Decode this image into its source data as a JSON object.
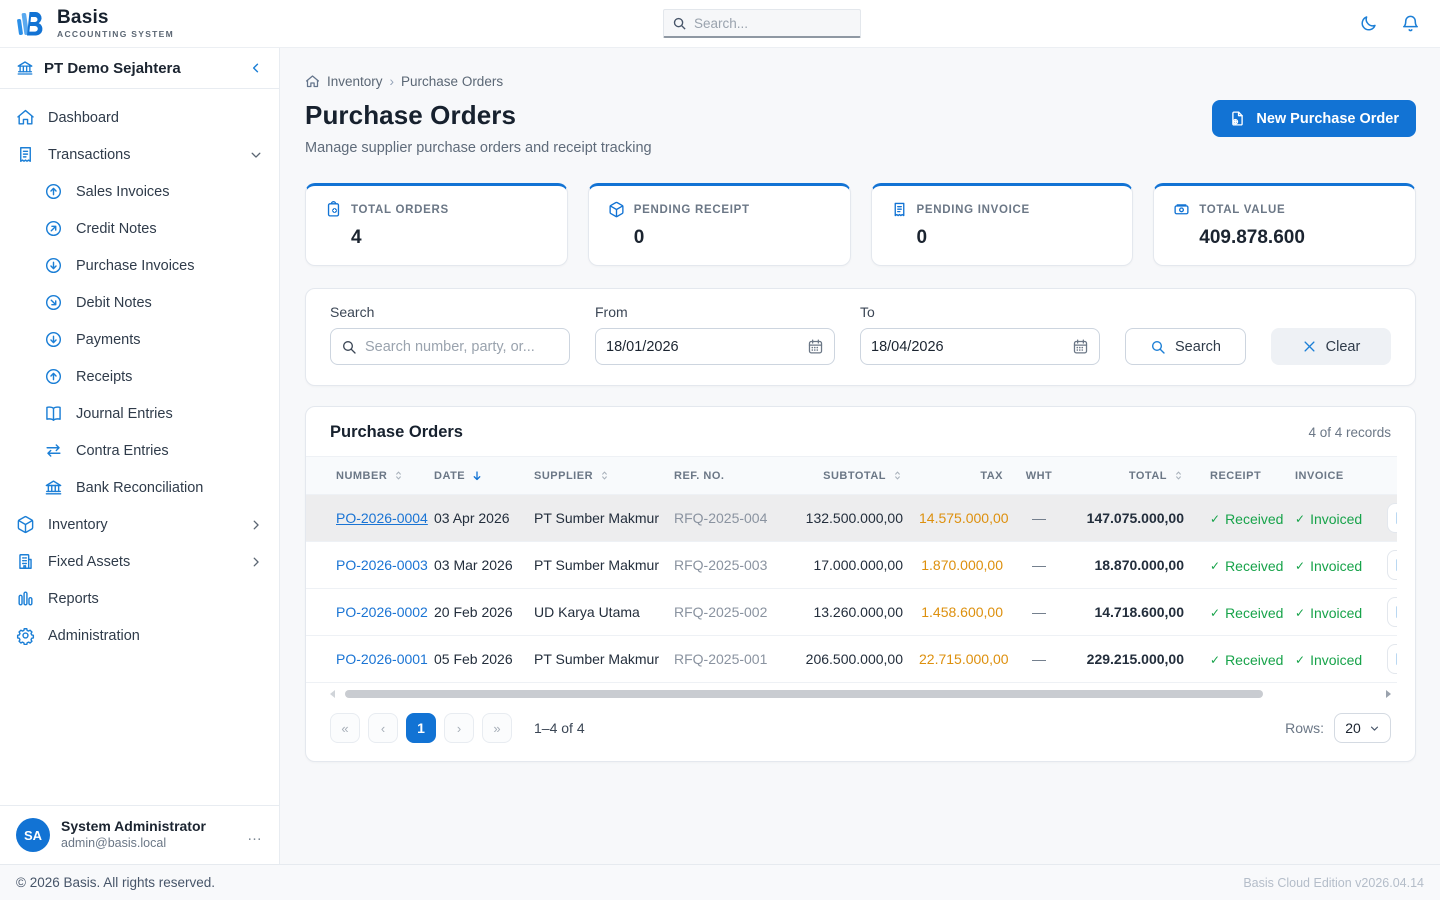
{
  "brand": {
    "name": "Basis",
    "tagline": "ACCOUNTING SYSTEM"
  },
  "topbar": {
    "search_placeholder": "Search..."
  },
  "sidebar": {
    "company": "PT Demo Sejahtera",
    "items": [
      {
        "label": "Dashboard",
        "icon": "home-icon"
      },
      {
        "label": "Transactions",
        "icon": "invoice-icon",
        "expanded": true,
        "children": [
          {
            "label": "Sales Invoices",
            "icon": "circle-arrow-up-icon"
          },
          {
            "label": "Credit Notes",
            "icon": "circle-arrow-up-right-icon"
          },
          {
            "label": "Purchase Invoices",
            "icon": "circle-arrow-down-icon"
          },
          {
            "label": "Debit Notes",
            "icon": "circle-arrow-down-right-icon"
          },
          {
            "label": "Payments",
            "icon": "circle-arrow-down-icon"
          },
          {
            "label": "Receipts",
            "icon": "circle-arrow-up-icon"
          },
          {
            "label": "Journal Entries",
            "icon": "book-open-icon"
          },
          {
            "label": "Contra Entries",
            "icon": "swap-arrows-icon"
          },
          {
            "label": "Bank Reconciliation",
            "icon": "bank-icon"
          }
        ]
      },
      {
        "label": "Inventory",
        "icon": "box-icon"
      },
      {
        "label": "Fixed Assets",
        "icon": "building-icon"
      },
      {
        "label": "Reports",
        "icon": "bar-chart-icon"
      },
      {
        "label": "Administration",
        "icon": "gear-icon"
      }
    ],
    "user": {
      "initials": "SA",
      "name": "System Administrator",
      "email": "admin@basis.local"
    }
  },
  "breadcrumb": {
    "item1": "Inventory",
    "item2": "Purchase Orders"
  },
  "page": {
    "title": "Purchase Orders",
    "subtitle": "Manage supplier purchase orders and receipt tracking",
    "new_button": "New Purchase Order"
  },
  "stats": [
    {
      "label": "TOTAL ORDERS",
      "value": "4",
      "icon": "clipboard-plus-icon"
    },
    {
      "label": "PENDING RECEIPT",
      "value": "0",
      "icon": "box-icon"
    },
    {
      "label": "PENDING INVOICE",
      "value": "0",
      "icon": "invoice-icon"
    },
    {
      "label": "TOTAL VALUE",
      "value": "409.878.600",
      "icon": "banknote-icon"
    }
  ],
  "filters": {
    "search_label": "Search",
    "search_placeholder": "Search number, party, or...",
    "from_label": "From",
    "from_value": "18/01/2026",
    "to_label": "To",
    "to_value": "18/04/2026",
    "search_button": "Search",
    "clear_button": "Clear"
  },
  "table": {
    "title": "Purchase Orders",
    "records_text": "4 of 4 records",
    "columns": {
      "number": "NUMBER",
      "date": "DATE",
      "supplier": "SUPPLIER",
      "ref": "REF. NO.",
      "subtotal": "SUBTOTAL",
      "tax": "TAX",
      "wht": "WHT",
      "total": "TOTAL",
      "receipt": "RECEIPT",
      "invoice": "INVOICE"
    },
    "rows": [
      {
        "number": "PO-2026-0004",
        "date": "03 Apr 2026",
        "supplier": "PT Sumber Makmur",
        "ref": "RFQ-2025-004",
        "subtotal": "132.500.000,00",
        "tax": "14.575.000,00",
        "wht": "—",
        "total": "147.075.000,00",
        "receipt": "Received",
        "invoice": "Invoiced"
      },
      {
        "number": "PO-2026-0003",
        "date": "03 Mar 2026",
        "supplier": "PT Sumber Makmur",
        "ref": "RFQ-2025-003",
        "subtotal": "17.000.000,00",
        "tax": "1.870.000,00",
        "wht": "—",
        "total": "18.870.000,00",
        "receipt": "Received",
        "invoice": "Invoiced"
      },
      {
        "number": "PO-2026-0002",
        "date": "20 Feb 2026",
        "supplier": "UD Karya Utama",
        "ref": "RFQ-2025-002",
        "subtotal": "13.260.000,00",
        "tax": "1.458.600,00",
        "wht": "—",
        "total": "14.718.600,00",
        "receipt": "Received",
        "invoice": "Invoiced"
      },
      {
        "number": "PO-2026-0001",
        "date": "05 Feb 2026",
        "supplier": "PT Sumber Makmur",
        "ref": "RFQ-2025-001",
        "subtotal": "206.500.000,00",
        "tax": "22.715.000,00",
        "wht": "—",
        "total": "229.215.000,00",
        "receipt": "Received",
        "invoice": "Invoiced"
      }
    ]
  },
  "pagination": {
    "first": "«",
    "prev": "‹",
    "page": "1",
    "next": "›",
    "last": "»",
    "range_text": "1–4 of 4",
    "rows_label": "Rows:",
    "rows_value": "20"
  },
  "icons": {
    "check": "✓",
    "ellipsis": "…",
    "breadcrumb_sep": "›"
  },
  "footer": {
    "left": "© 2026 Basis. All rights reserved.",
    "right": "Basis Cloud Edition v2026.04.14"
  },
  "colors": {
    "primary": "#1273d4",
    "link": "#1a74d4",
    "tax": "#dd900e",
    "success": "#17a34a",
    "row_highlight": "#ededee"
  }
}
